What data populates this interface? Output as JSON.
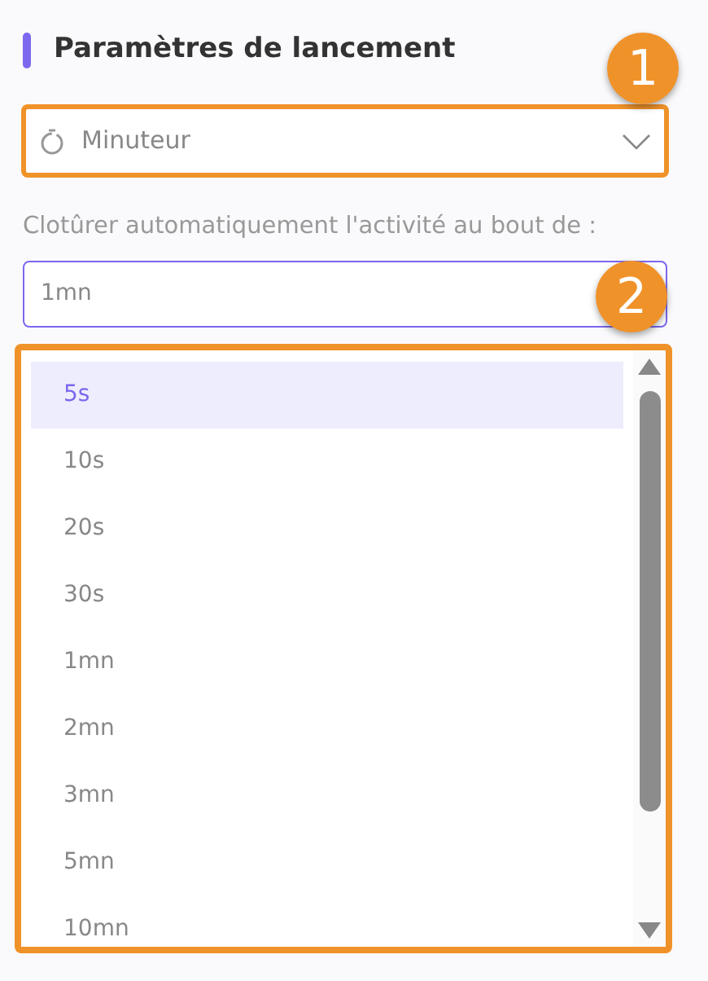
{
  "section": {
    "title": "Paramètres de lancement"
  },
  "trigger_select": {
    "value": "Minuteur",
    "callout": "1"
  },
  "duration": {
    "label": "Clotûrer automatiquement l'activité au bout de :",
    "value": "1mn",
    "callout": "2"
  },
  "options": [
    {
      "label": "5s",
      "selected": true
    },
    {
      "label": "10s",
      "selected": false
    },
    {
      "label": "20s",
      "selected": false
    },
    {
      "label": "30s",
      "selected": false
    },
    {
      "label": "1mn",
      "selected": false
    },
    {
      "label": "2mn",
      "selected": false
    },
    {
      "label": "3mn",
      "selected": false
    },
    {
      "label": "5mn",
      "selected": false
    },
    {
      "label": "10mn",
      "selected": false
    }
  ]
}
